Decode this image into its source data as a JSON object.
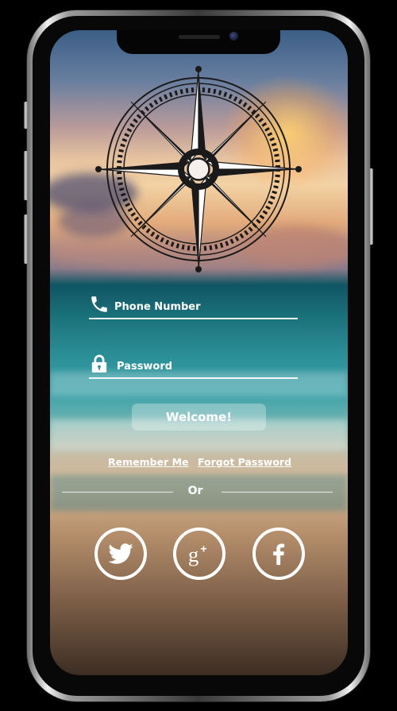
{
  "login": {
    "phone_label": "Phone Number",
    "password_label": "Password",
    "submit_label": "Welcome!",
    "remember_label": "Remember Me",
    "forgot_label": "Forgot Password",
    "divider_label": "Or"
  },
  "social": [
    {
      "icon": "twitter-icon"
    },
    {
      "icon": "google-plus-icon"
    },
    {
      "icon": "facebook-icon"
    }
  ],
  "colors": {
    "text": "#ffffff",
    "button_bg": "rgba(255,255,255,0.3)",
    "compass": "#1a1a1a"
  }
}
